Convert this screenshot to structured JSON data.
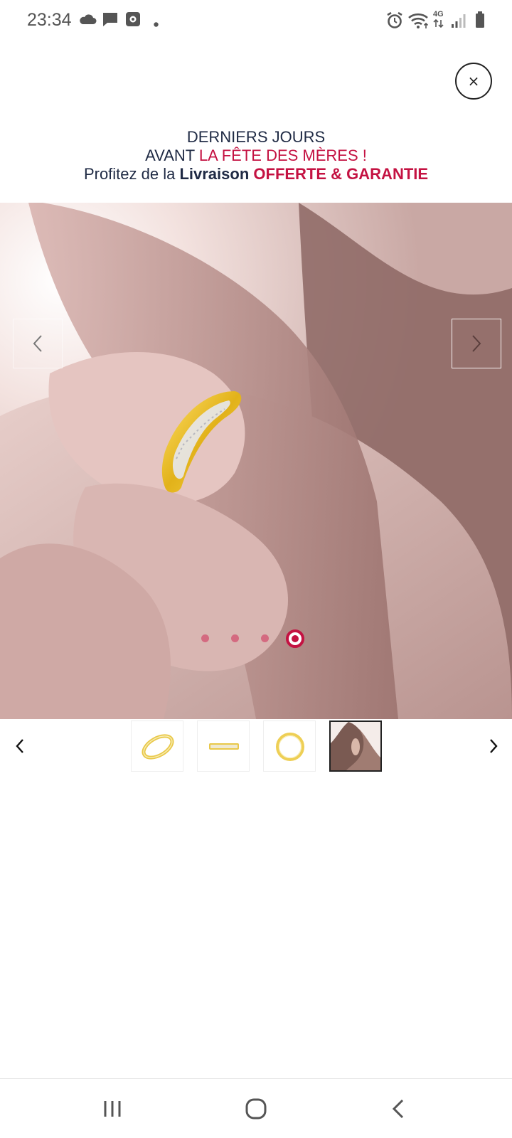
{
  "status_bar": {
    "time": "23:34",
    "left_icons": [
      "cloud-icon",
      "message-icon",
      "screen-record-icon",
      "dot-icon"
    ],
    "right_icons": [
      "alarm-icon",
      "wifi-icon",
      "network-4g-icon",
      "signal-icon",
      "battery-icon"
    ],
    "network_label": "4G"
  },
  "close_button": {
    "label": "×"
  },
  "promo": {
    "line1": "DERNIERS JOURS",
    "line2_prefix": "AVANT ",
    "line2_highlight": "LA FÊTE DES MÈRES !",
    "line3_prefix": "Profitez de la ",
    "line3_bold": "Livraison",
    "line3_highlight": "OFFERTE & GARANTIE",
    "text_color": "#1f2a44",
    "highlight_color": "#c41242"
  },
  "gallery": {
    "slide_count": 4,
    "active_slide": 4,
    "thumbnails": [
      {
        "name": "ring-angled-thumbnail"
      },
      {
        "name": "ring-side-thumbnail"
      },
      {
        "name": "ring-top-thumbnail"
      },
      {
        "name": "ring-worn-thumbnail",
        "selected": true
      }
    ]
  },
  "nav_bar": {
    "buttons": [
      "recent-apps-icon",
      "home-icon",
      "back-icon"
    ]
  }
}
